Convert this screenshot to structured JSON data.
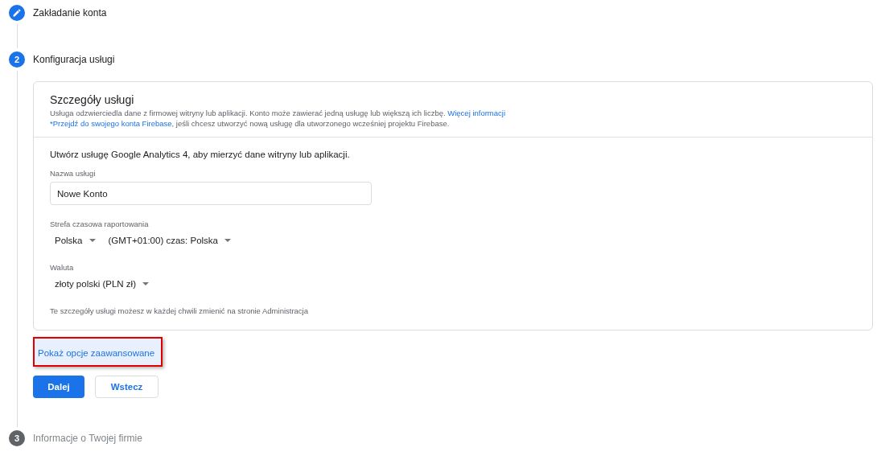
{
  "steps": [
    {
      "title": "Zakładanie konta",
      "completed": true,
      "current": false
    },
    {
      "number": "2",
      "title": "Konfiguracja usługi",
      "completed": false,
      "current": true
    },
    {
      "number": "3",
      "title": "Informacje o Twojej firmie",
      "completed": false,
      "current": false
    }
  ],
  "card": {
    "title": "Szczegóły usługi",
    "description": [
      [
        {
          "kind": "text",
          "text": "Usługa odzwierciedla dane z firmowej witryny lub aplikacji. Konto może zawierać jedną usługę lub większą ich liczbę. "
        },
        {
          "kind": "link",
          "text": "Więcej informacji"
        }
      ],
      [
        {
          "kind": "link",
          "text": "*Przejdź do swojego konta Firebase"
        },
        {
          "kind": "text",
          "text": ", jeśli chcesz utworzyć nową usługę dla utworzonego wcześniej projektu Firebase."
        }
      ]
    ],
    "intro": "Utwórz usługę Google Analytics 4, aby mierzyć dane witryny lub aplikacji.",
    "name_field": {
      "label": "Nazwa usługi",
      "value": "Nowe Konto"
    },
    "timezone": {
      "label": "Strefa czasowa raportowania",
      "selects": [
        "Polska",
        "(GMT+01:00) czas: Polska"
      ]
    },
    "currency": {
      "label": "Waluta",
      "selects": [
        "złoty polski (PLN zł)"
      ]
    },
    "note": "Te szczegóły usługi możesz w każdej chwili zmienić na stronie Administracja"
  },
  "advanced_link": {
    "text": "Pokaż opcje zaawansowane",
    "highlighted": true
  },
  "buttons": [
    {
      "label": "Dalej",
      "kind": "primary"
    },
    {
      "label": "Wstecz",
      "kind": "secondary"
    }
  ]
}
